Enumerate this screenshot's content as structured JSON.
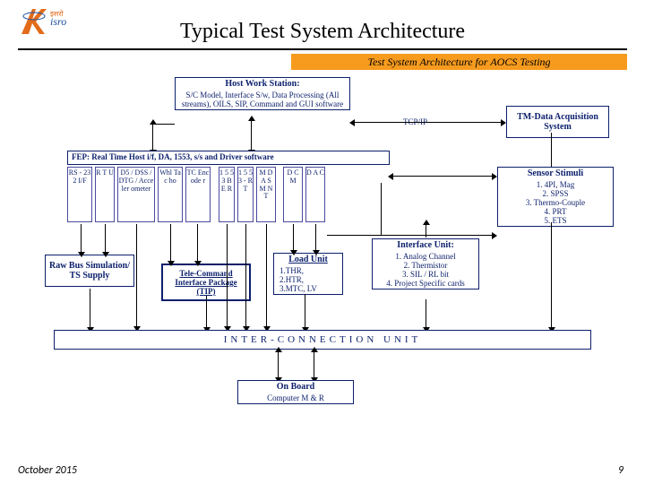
{
  "title": "Typical Test System Architecture",
  "banner": "Test System Architecture for AOCS Testing",
  "footer": {
    "date": "October 2015",
    "page": "9"
  },
  "logo_alt": "ISRO",
  "tcpip": "TCP/IP",
  "host": {
    "hdr": "Host Work Station:",
    "body": "S/C Model, Interface S/w, Data Processing (All streams), OILS, SIP, Command and GUI software"
  },
  "tm": {
    "hdr": "TM-Data Acquisition System"
  },
  "fep": "FEP: Real Time Host i/f, DA, 1553, s/s and Driver software",
  "cols": [
    "RS - 232 I/F",
    "R T U",
    "D5 / DSS / DTG / Acceler ometer",
    "Whl Tac ho",
    "TC Enc ode r",
    "1 5 5 3 B E R",
    "1 5 5 3 - R T",
    "M D A S M N T",
    "D C M",
    "D A C"
  ],
  "sensor": {
    "hdr": "Sensor Stimuli",
    "items": [
      "4PI, Mag",
      "SPSS",
      "Thermo-Couple",
      "PRT",
      "ETS"
    ]
  },
  "rawbus": {
    "hdr": "Raw Bus Simulation/ TS Supply"
  },
  "tip": {
    "hdr": "Tele-Command Interface Package (TIP)"
  },
  "load": {
    "hdr": "Load Unit",
    "body": "1.THR,\n2.HTR,\n3.MTC, LV"
  },
  "ifu": {
    "hdr": "Interface Unit:",
    "items": [
      "Analog Channel",
      "Thermistor",
      "SIL / RL bit",
      "Project Specific cards"
    ]
  },
  "icu": "INTER-CONNECTION  UNIT",
  "obc": {
    "hdr": "On Board",
    "body": "Computer M & R"
  }
}
